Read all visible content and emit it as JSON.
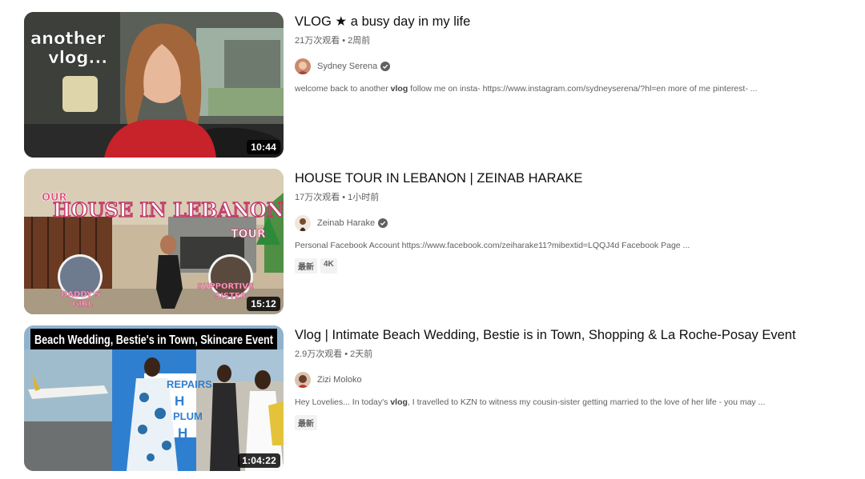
{
  "results": [
    {
      "title": "VLOG ★ a busy day in my life",
      "views": "21万次观看",
      "age": "2周前",
      "channel": "Sydney Serena",
      "verified": true,
      "description_pre": "welcome back to another ",
      "description_bold": "vlog",
      "description_post": " follow me on insta- https://www.instagram.com/sydneyserena/?hl=en more of me pinterest- ...",
      "badges": [],
      "duration": "10:44",
      "thumb_text": [
        "another",
        "vlog..."
      ]
    },
    {
      "title": "HOUSE TOUR IN LEBANON | ZEINAB HARAKE",
      "views": "17万次观看",
      "age": "1小时前",
      "channel": "Zeinab Harake",
      "verified": true,
      "description_pre": "Personal Facebook Account https://www.facebook.com/zeiharake11?mibextid=LQQJ4d Facebook Page ...",
      "description_bold": "",
      "description_post": "",
      "badges": [
        "最新",
        "4K"
      ],
      "duration": "15:12",
      "thumb_text": [
        "OUR",
        "HOUSE IN LEBANON",
        "TOUR",
        "DADDY'S",
        "GIRL",
        "SUPPORTIVE",
        "SISTER"
      ]
    },
    {
      "title": "Vlog | Intimate Beach Wedding, Bestie is in Town, Shopping & La Roche-Posay Event",
      "views": "2.9万次观看",
      "age": "2天前",
      "channel": "Zizi Moloko",
      "verified": false,
      "description_pre": "Hey Lovelies... In today's ",
      "description_bold": "vlog",
      "description_post": ", I travelled to KZN to witness my cousin-sister getting married to the love of her life - you may ...",
      "badges": [
        "最新"
      ],
      "duration": "1:04:22",
      "thumb_text": [
        "Beach Wedding, Bestie's in Town, Skincare Event",
        "REPAIRS",
        "H",
        "PLUM",
        "H"
      ]
    }
  ]
}
